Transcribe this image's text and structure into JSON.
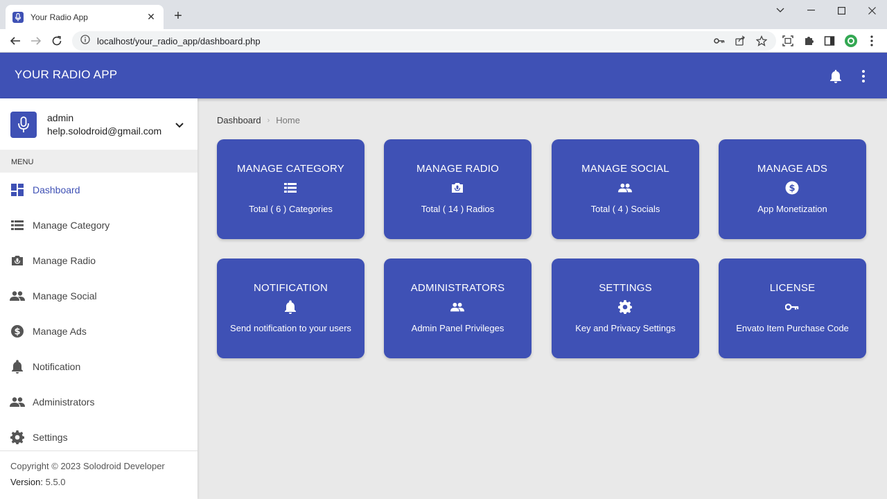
{
  "browser": {
    "tab_title": "Your Radio App",
    "tab_close": "✕",
    "new_tab": "+",
    "url": "localhost/your_radio_app/dashboard.php"
  },
  "header": {
    "title": "YOUR RADIO APP"
  },
  "user": {
    "name": "admin",
    "email": "help.solodroid@gmail.com"
  },
  "sidebar": {
    "menu_header": "MENU",
    "items": [
      {
        "label": "Dashboard",
        "icon": "dashboard-icon",
        "active": true
      },
      {
        "label": "Manage Category",
        "icon": "list-icon"
      },
      {
        "label": "Manage Radio",
        "icon": "radio-icon"
      },
      {
        "label": "Manage Social",
        "icon": "people-icon"
      },
      {
        "label": "Manage Ads",
        "icon": "dollar-icon"
      },
      {
        "label": "Notification",
        "icon": "bell-icon"
      },
      {
        "label": "Administrators",
        "icon": "people-icon"
      },
      {
        "label": "Settings",
        "icon": "gear-icon"
      }
    ],
    "footer": {
      "copyright": "Copyright © 2023 Solodroid Developer",
      "version_label": "Version:",
      "version": "5.5.0"
    }
  },
  "breadcrumb": {
    "first": "Dashboard",
    "separator": "›",
    "last": "Home"
  },
  "cards": [
    {
      "title": "MANAGE CATEGORY",
      "subtitle": "Total ( 6 ) Categories",
      "icon": "list-icon"
    },
    {
      "title": "MANAGE RADIO",
      "subtitle": "Total ( 14 ) Radios",
      "icon": "radio-icon"
    },
    {
      "title": "MANAGE SOCIAL",
      "subtitle": "Total ( 4 ) Socials",
      "icon": "people-icon"
    },
    {
      "title": "MANAGE ADS",
      "subtitle": "App Monetization",
      "icon": "dollar-icon"
    },
    {
      "title": "NOTIFICATION",
      "subtitle": "Send notification to your users",
      "icon": "bell-icon"
    },
    {
      "title": "ADMINISTRATORS",
      "subtitle": "Admin Panel Privileges",
      "icon": "people-icon"
    },
    {
      "title": "SETTINGS",
      "subtitle": "Key and Privacy Settings",
      "icon": "gear-icon"
    },
    {
      "title": "LICENSE",
      "subtitle": "Envato Item Purchase Code",
      "icon": "key-icon"
    }
  ],
  "colors": {
    "primary": "#3f51b5",
    "background": "#e9e9e9",
    "sidebar": "#ffffff"
  }
}
